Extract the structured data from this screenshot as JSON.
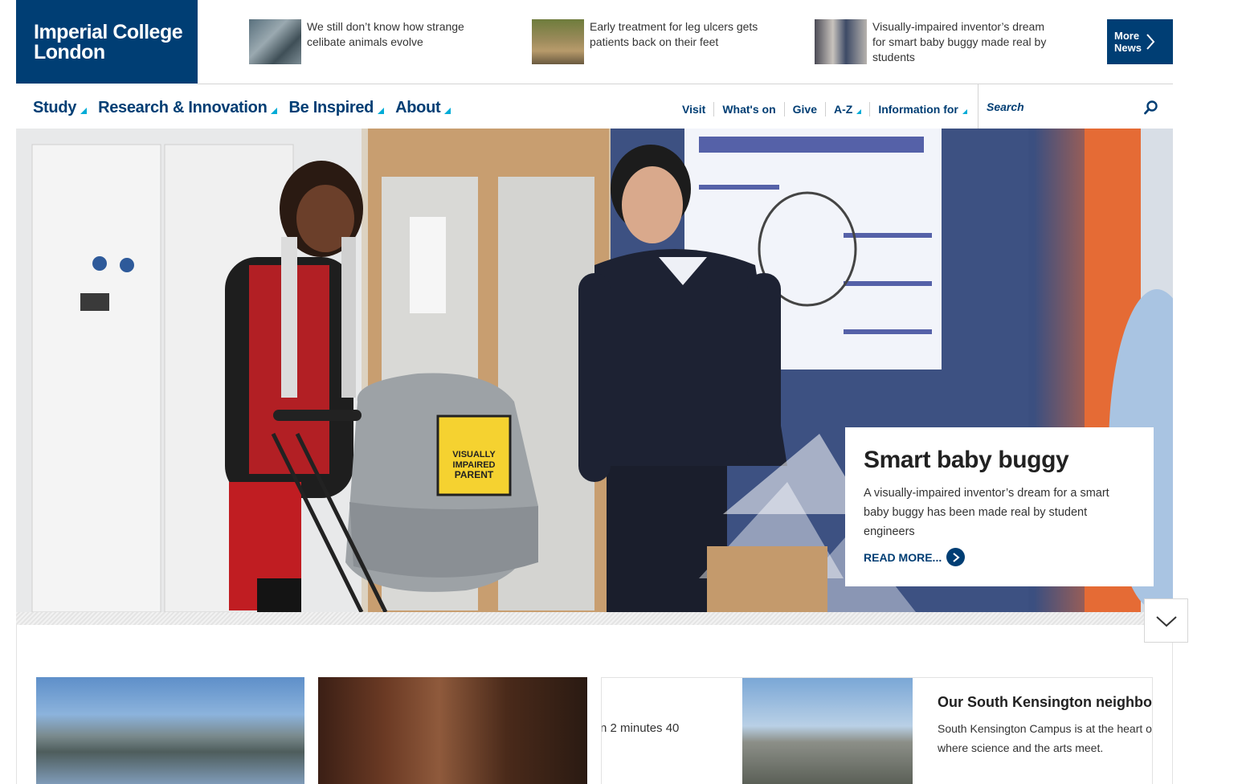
{
  "logo": {
    "line1": "Imperial College",
    "line2": "London"
  },
  "news": [
    {
      "text": "We still don’t know how strange celibate animals evolve"
    },
    {
      "text": "Early treatment for leg ulcers gets patients back on their feet"
    },
    {
      "text": "Visually-impaired inventor’s dream for smart baby buggy made real by students"
    }
  ],
  "more_news": {
    "line1": "More",
    "line2": "News"
  },
  "main_nav": [
    {
      "label": "Study"
    },
    {
      "label": "Research & Innovation"
    },
    {
      "label": "Be Inspired"
    },
    {
      "label": "About"
    }
  ],
  "util_nav": [
    {
      "label": "Visit"
    },
    {
      "label": "What's on"
    },
    {
      "label": "Give"
    },
    {
      "label": "A-Z"
    },
    {
      "label": "Information for"
    }
  ],
  "search": {
    "placeholder": "Search"
  },
  "hero": {
    "badge": [
      "VISUALLY",
      "IMPAIRED",
      "PARENT"
    ],
    "title": "Smart baby buggy",
    "description": "A visually-impaired inventor’s dream for a smart baby buggy has been made real by student engineers",
    "read_more": "READ MORE..."
  },
  "cards": {
    "video_text": "n 2 minutes 40",
    "feature_title": "Our South Kensington neighbourhood",
    "feature_desc": "South Kensington Campus is at the heart of where science and the arts meet."
  },
  "colors": {
    "brand_navy": "#003e74",
    "accent_cyan": "#00acd7"
  }
}
